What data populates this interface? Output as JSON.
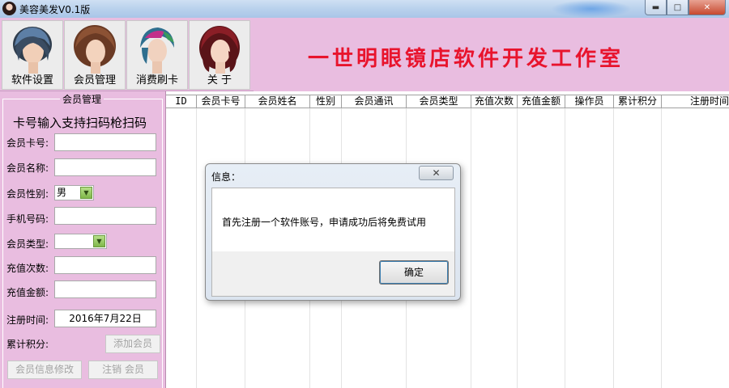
{
  "window": {
    "title": "美容美发V0.1版",
    "buttons": {
      "minimize": "▬",
      "maximize": "□",
      "close": "✕"
    }
  },
  "toolbar": {
    "items": [
      {
        "label": "软件设置",
        "icon": "portrait-blue-hair-icon"
      },
      {
        "label": "会员管理",
        "icon": "portrait-brown-hair-icon"
      },
      {
        "label": "消费刷卡",
        "icon": "portrait-colored-hair-icon"
      },
      {
        "label": "关 于",
        "icon": "portrait-red-hair-icon"
      }
    ],
    "banner": "一世明眼镜店软件开发工作室",
    "banner_color": "#e8142d"
  },
  "member_panel": {
    "group_title": "会员管理",
    "scan_hint": "卡号输入支持扫码枪扫码",
    "fields": {
      "card_no_label": "会员卡号:",
      "name_label": "会员名称:",
      "gender_label": "会员性别:",
      "gender_value": "男",
      "phone_label": "手机号码:",
      "type_label": "会员类型:",
      "type_value": "",
      "recharge_count_label": "充值次数:",
      "recharge_amount_label": "充值金额:",
      "register_time_label": "注册时间:",
      "register_time_value": "2016年7月22日",
      "points_label": "累计积分:"
    },
    "buttons": {
      "add": "添加会员",
      "modify": "会员信息修改",
      "cancel": "注销 会员"
    }
  },
  "grid": {
    "columns": [
      "ID",
      "会员卡号",
      "会员姓名",
      "性别",
      "会员通讯",
      "会员类型",
      "充值次数",
      "充值金额",
      "操作员",
      "累计积分",
      "注册时间"
    ]
  },
  "dialog": {
    "title": "信息：",
    "close": "✕",
    "message": "首先注册一个软件账号，申请成功后将免费试用",
    "ok": "确定"
  },
  "colors": {
    "panel_bg": "#e9bde0",
    "titlebar": "#b9d1ec"
  }
}
